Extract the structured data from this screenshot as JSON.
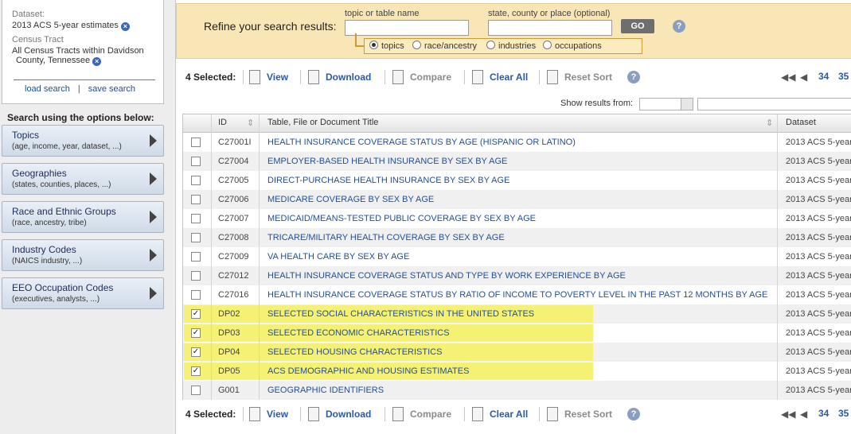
{
  "sidebar": {
    "dataset_label": "Dataset:",
    "dataset_value": "2013 ACS 5-year estimates",
    "tract_label": "Census Tract",
    "tract_value_line1": "All Census Tracts within Davidson",
    "tract_value_line2": "County, Tennessee",
    "load_search": "load search",
    "separator": "|",
    "save_search": "save search",
    "options_title": "Search using the options below:",
    "options": [
      {
        "title": "Topics",
        "sub": "(age, income, year, dataset, ...)"
      },
      {
        "title": "Geographies",
        "sub": "(states, counties, places, ...)"
      },
      {
        "title": "Race and Ethnic Groups",
        "sub": "(race, ancestry, tribe)"
      },
      {
        "title": "Industry Codes",
        "sub": "(NAICS industry, ...)"
      },
      {
        "title": "EEO Occupation Codes",
        "sub": "(executives, analysts, ...)"
      }
    ]
  },
  "refine": {
    "label": "Refine your search results:",
    "topic_caption": "topic or table name",
    "place_caption": "state, county or place (optional)",
    "topic_value": "",
    "place_value": "",
    "go": "GO",
    "help": "?",
    "radios": [
      {
        "label": "topics",
        "selected": true
      },
      {
        "label": "race/ancestry",
        "selected": false
      },
      {
        "label": "industries",
        "selected": false
      },
      {
        "label": "occupations",
        "selected": false
      }
    ]
  },
  "toolbar": {
    "selected": "4 Selected:",
    "view": "View",
    "download": "Download",
    "compare": "Compare",
    "clear_all": "Clear All",
    "reset_sort": "Reset Sort",
    "help": "?",
    "pages": [
      "34",
      "35"
    ]
  },
  "show_results": {
    "label": "Show results from:"
  },
  "table": {
    "headers": {
      "id": "ID",
      "title": "Table, File or Document Title",
      "dataset": "Dataset"
    },
    "rows": [
      {
        "id": "C27001I",
        "title": "HEALTH INSURANCE COVERAGE STATUS BY AGE (HISPANIC OR LATINO)",
        "dataset": "2013 ACS 5-year",
        "checked": false
      },
      {
        "id": "C27004",
        "title": "EMPLOYER-BASED HEALTH INSURANCE BY SEX BY AGE",
        "dataset": "2013 ACS 5-year",
        "checked": false
      },
      {
        "id": "C27005",
        "title": "DIRECT-PURCHASE HEALTH INSURANCE BY SEX BY AGE",
        "dataset": "2013 ACS 5-year",
        "checked": false
      },
      {
        "id": "C27006",
        "title": "MEDICARE COVERAGE BY SEX BY AGE",
        "dataset": "2013 ACS 5-year",
        "checked": false
      },
      {
        "id": "C27007",
        "title": "MEDICAID/MEANS-TESTED PUBLIC COVERAGE BY SEX BY AGE",
        "dataset": "2013 ACS 5-year",
        "checked": false
      },
      {
        "id": "C27008",
        "title": "TRICARE/MILITARY HEALTH COVERAGE BY SEX BY AGE",
        "dataset": "2013 ACS 5-year",
        "checked": false
      },
      {
        "id": "C27009",
        "title": "VA HEALTH CARE BY SEX BY AGE",
        "dataset": "2013 ACS 5-year",
        "checked": false
      },
      {
        "id": "C27012",
        "title": "HEALTH INSURANCE COVERAGE STATUS AND TYPE BY WORK EXPERIENCE BY AGE",
        "dataset": "2013 ACS 5-year",
        "checked": false
      },
      {
        "id": "C27016",
        "title": "HEALTH INSURANCE COVERAGE STATUS BY RATIO OF INCOME TO POVERTY LEVEL IN THE PAST 12 MONTHS BY AGE",
        "dataset": "2013 ACS 5-year",
        "checked": false
      },
      {
        "id": "DP02",
        "title": "SELECTED SOCIAL CHARACTERISTICS IN THE UNITED STATES",
        "dataset": "2013 ACS 5-year",
        "checked": true
      },
      {
        "id": "DP03",
        "title": "SELECTED ECONOMIC CHARACTERISTICS",
        "dataset": "2013 ACS 5-year",
        "checked": true
      },
      {
        "id": "DP04",
        "title": "SELECTED HOUSING CHARACTERISTICS",
        "dataset": "2013 ACS 5-year",
        "checked": true
      },
      {
        "id": "DP05",
        "title": "ACS DEMOGRAPHIC AND HOUSING ESTIMATES",
        "dataset": "2013 ACS 5-year",
        "checked": true
      },
      {
        "id": "G001",
        "title": "GEOGRAPHIC IDENTIFIERS",
        "dataset": "2013 ACS 5-year",
        "checked": false
      }
    ]
  },
  "colors": {
    "highlight": "#f5f174",
    "link": "#1f4e9c",
    "refine_bg": "#f9e6b6"
  }
}
